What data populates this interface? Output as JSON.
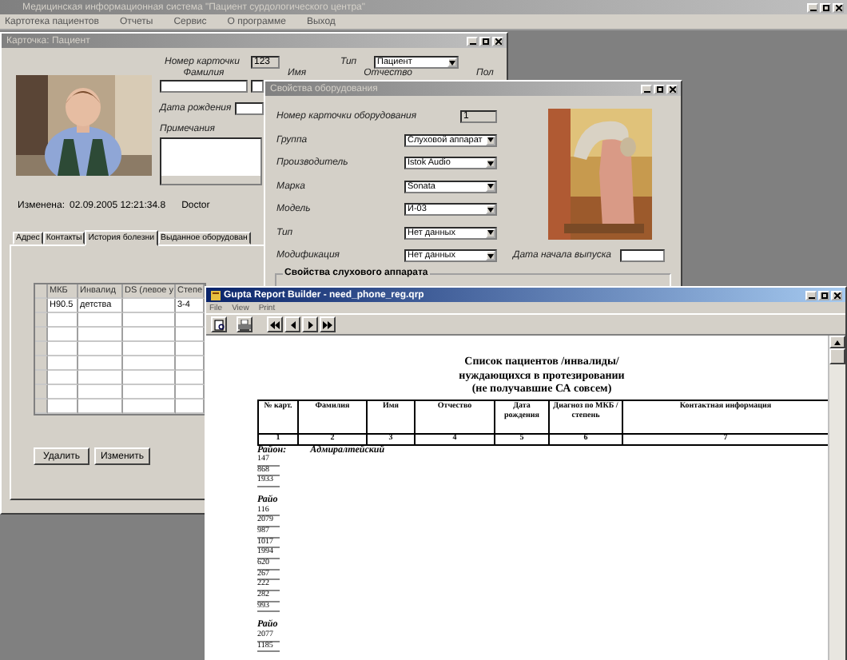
{
  "app": {
    "title": "Медицинская информационная система \"Пациент сурдологического центра\"",
    "menu": [
      "Картотека пациентов",
      "Отчеты",
      "Сервис",
      "О программе",
      "Выход"
    ]
  },
  "patient_window": {
    "title": "Карточка: Пациент",
    "photo": {
      "kind": "picture"
    },
    "card_number": {
      "label": "Номер карточки",
      "value": "123"
    },
    "type": {
      "label": "Тип",
      "value": "Пациент"
    },
    "name_labels": [
      "Фамилия",
      "Имя",
      "Отчество",
      "Пол"
    ],
    "birth_date": {
      "label": "Дата рождения"
    },
    "notes": {
      "label": "Примечания"
    },
    "modified": {
      "label": "Изменена:",
      "value": "02.09.2005 12:21:34.8",
      "user": "Doctor"
    },
    "tabs": [
      {
        "label": "Адрес",
        "selected": false
      },
      {
        "label": "Контакты",
        "selected": false
      },
      {
        "label": "История болезни",
        "selected": true
      },
      {
        "label": "Выданное оборудован",
        "selected": false
      }
    ],
    "grid": {
      "columns": [
        "МКБ",
        "Инвалид",
        "DS (левое у",
        "Степе"
      ],
      "rows": [
        [
          "H90.5",
          "детства",
          null,
          "3-4"
        ]
      ]
    },
    "buttons": [
      "Удалить",
      "Изменить"
    ]
  },
  "equipment_window": {
    "title": "Свойства оборудования",
    "card_number": {
      "label": "Номер карточки оборудования",
      "value": "1"
    },
    "fields": [
      {
        "label": "Группа",
        "value": "Слуховой аппарат"
      },
      {
        "label": "Производитель",
        "value": "Istok Audio"
      },
      {
        "label": "Марка",
        "value": "Sonata"
      },
      {
        "label": "Модель",
        "value": "И-03"
      },
      {
        "label": "Тип",
        "value": "Нет данных"
      },
      {
        "label": "Модификация",
        "value": "Нет данных"
      }
    ],
    "release_date": {
      "label": "Дата начала выпуска"
    },
    "photo": {
      "kind": "picture"
    },
    "group_box": "Свойства слухового аппарата"
  },
  "report_window": {
    "title": "Gupta Report Builder - need_phone_reg.qrp",
    "menu": [
      "File",
      "View",
      "Print"
    ],
    "report": {
      "title_lines": [
        "Список пациентов /инвалиды/",
        "нуждающихся в протезировании",
        "(не получавшие СА совсем)"
      ],
      "columns": [
        {
          "heading": "№ карт.",
          "number": "1"
        },
        {
          "heading": "Фамилия",
          "number": "2"
        },
        {
          "heading": "Имя",
          "number": "3"
        },
        {
          "heading": "Отчество",
          "number": "4"
        },
        {
          "heading": "Дата рождения",
          "number": "5"
        },
        {
          "heading": "Диагноз по МКБ / степень",
          "number": "6"
        },
        {
          "heading": "Контактная информация",
          "number": "7"
        }
      ],
      "sections": [
        {
          "label": "Район:",
          "name": "Адмиралтейский",
          "ids": [
            "147",
            "868",
            "1933"
          ]
        },
        {
          "label": "Райо",
          "ids": [
            "116",
            "2079",
            "987",
            "1017",
            "1994",
            "620",
            "267",
            "222",
            "282",
            "993"
          ]
        },
        {
          "label": "Райо",
          "ids": [
            "2077",
            "1185"
          ]
        }
      ]
    }
  }
}
